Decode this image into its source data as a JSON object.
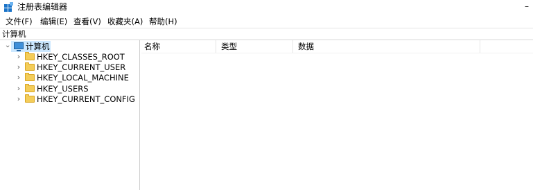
{
  "window": {
    "title": "注册表编辑器",
    "minimize_glyph": "–",
    "app_icon": "registry-editor-icon"
  },
  "menu": [
    "文件(F)",
    "编辑(E)",
    "查看(V)",
    "收藏夹(A)",
    "帮助(H)"
  ],
  "address": "计算机",
  "tree": {
    "root": {
      "label": "计算机",
      "expanded": true,
      "selected": true,
      "icon": "computer-icon"
    },
    "children": [
      {
        "label": "HKEY_CLASSES_ROOT"
      },
      {
        "label": "HKEY_CURRENT_USER"
      },
      {
        "label": "HKEY_LOCAL_MACHINE"
      },
      {
        "label": "HKEY_USERS"
      },
      {
        "label": "HKEY_CURRENT_CONFIG"
      }
    ]
  },
  "list": {
    "columns": [
      "名称",
      "类型",
      "数据"
    ]
  },
  "colors": {
    "selection": "#cce8ff",
    "folder": "#f4cd59",
    "computer": "#3f8fd9"
  }
}
